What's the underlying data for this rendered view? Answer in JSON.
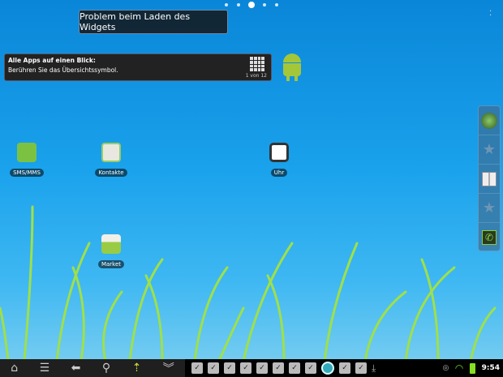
{
  "pager": {
    "pages": 5,
    "current": 3
  },
  "toast": {
    "text": "Problem beim Laden des Widgets"
  },
  "tip": {
    "title": "Alle Apps auf einen Blick:",
    "text": "Berühren Sie das Übersichtssymbol.",
    "page": "1 von 12"
  },
  "apps": [
    {
      "label": "SMS/MMS",
      "icon": "sms-icon"
    },
    {
      "label": "Kontakte",
      "icon": "contacts-icon"
    },
    {
      "label": "Uhr",
      "icon": "clock-icon"
    },
    {
      "label": "Market",
      "icon": "market-icon"
    }
  ],
  "dock": [
    "globe-icon",
    "star-icon",
    "apps-grid-icon",
    "star-icon",
    "phone-icon"
  ],
  "nav": [
    "home-icon",
    "menu-icon",
    "back-icon",
    "search-icon",
    "upload-icon",
    "collapse-icon"
  ],
  "notifications": [
    "task-icon",
    "task-icon",
    "task-icon",
    "task-icon",
    "task-icon",
    "task-icon",
    "task-icon",
    "task-icon",
    "android-circle-icon",
    "task-icon",
    "task-icon",
    "download-icon"
  ],
  "status": {
    "time": "9:54",
    "sync": "sync-icon",
    "wifi": "wifi-icon",
    "battery": "battery-icon"
  }
}
